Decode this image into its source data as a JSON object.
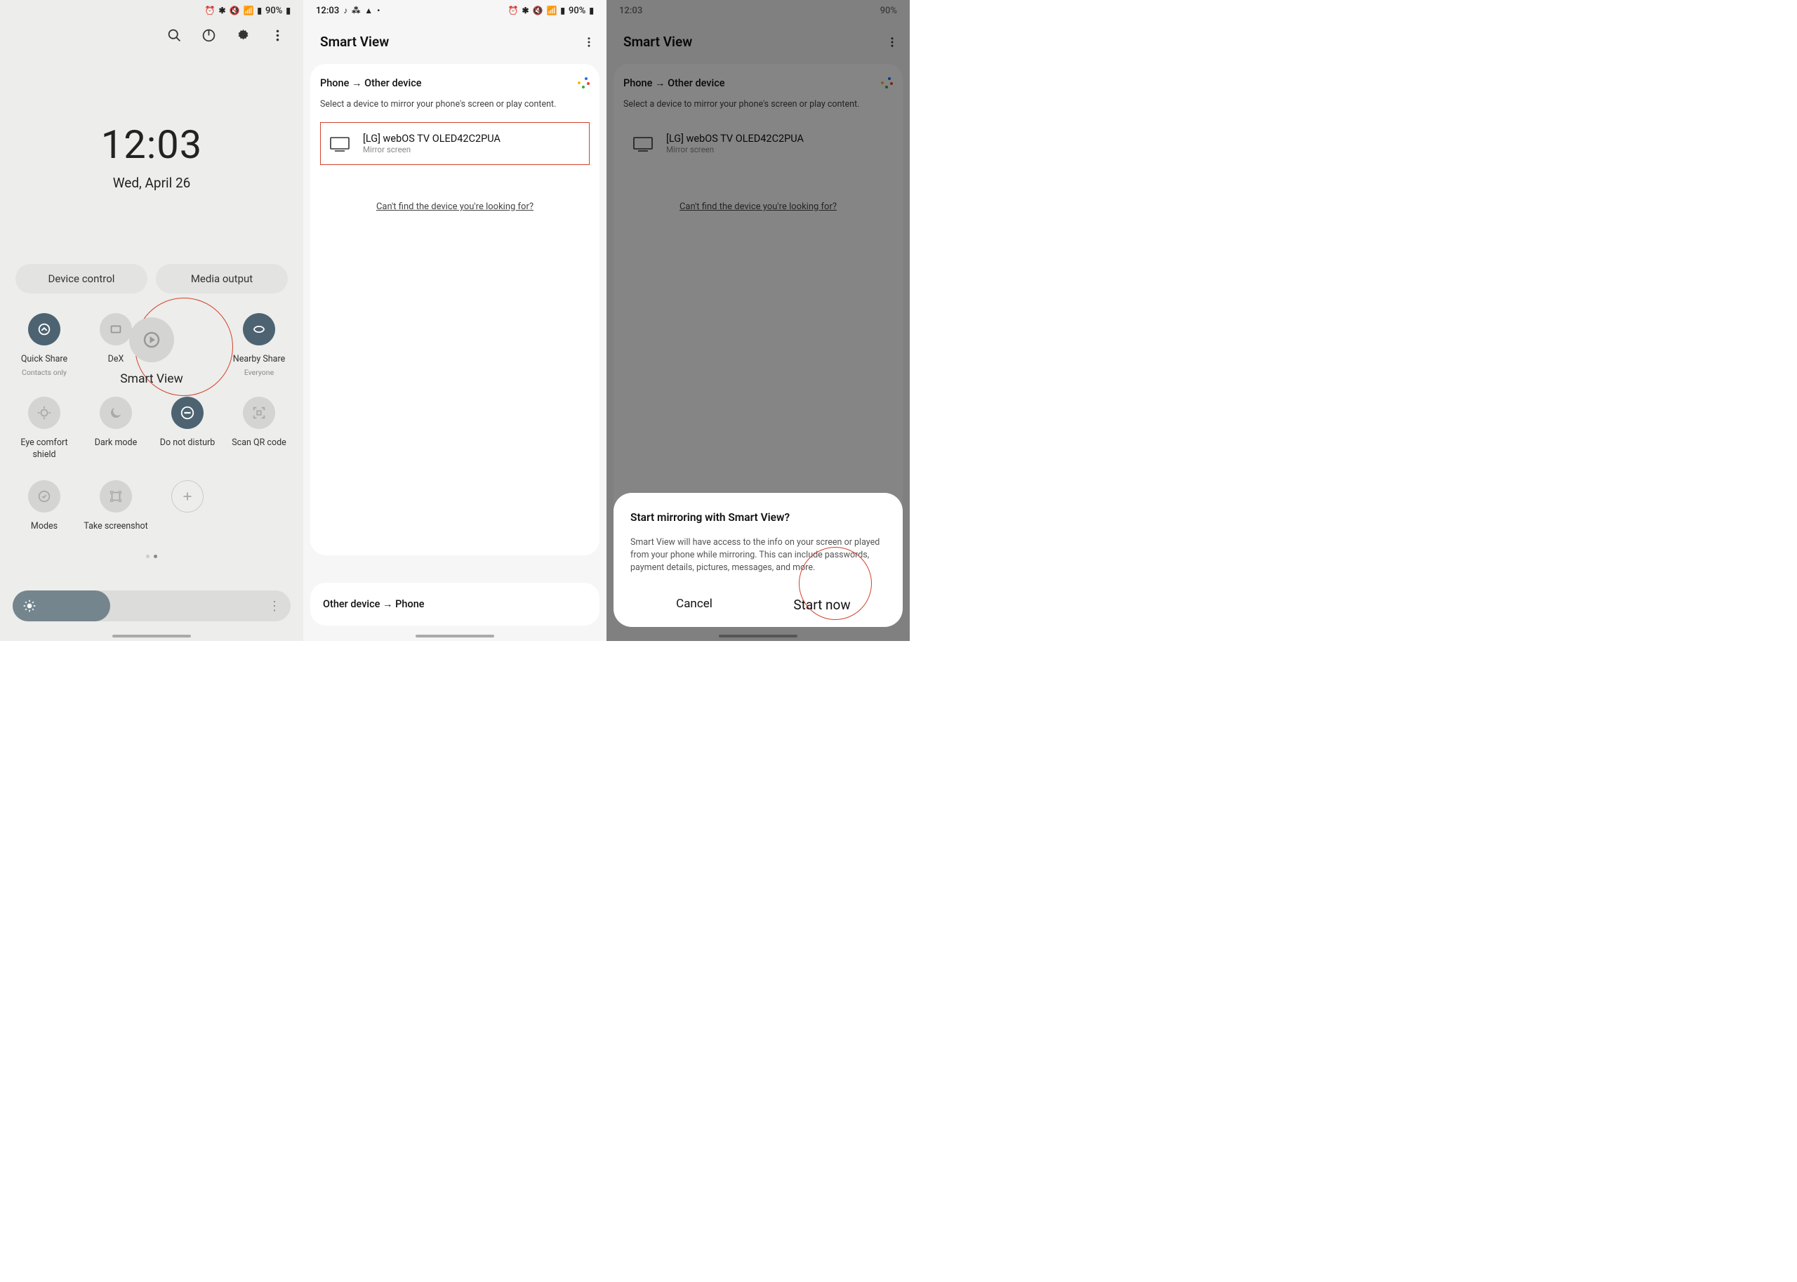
{
  "status": {
    "time": "12:03",
    "battery": "90%"
  },
  "shot1": {
    "clock_time": "12:03",
    "clock_date": "Wed, April 26",
    "pills": {
      "a": "Device control",
      "b": "Media output"
    },
    "tiles": {
      "quickshare": {
        "label": "Quick Share",
        "sub": "Contacts only"
      },
      "dex": {
        "label": "DeX"
      },
      "smartview": {
        "label": "Smart View"
      },
      "nearby": {
        "label": "Nearby Share",
        "sub": "Everyone"
      },
      "eyecomfort": {
        "label": "Eye comfort shield"
      },
      "darkmode": {
        "label": "Dark mode"
      },
      "dnd": {
        "label": "Do not disturb"
      },
      "scanqr": {
        "label": "Scan QR code"
      },
      "modes": {
        "label": "Modes"
      },
      "screenshot": {
        "label": "Take screenshot"
      },
      "add": {
        "label": ""
      }
    }
  },
  "smartview": {
    "title": "Smart View",
    "direction_out": "Phone → Other device",
    "hint": "Select a device to mirror your phone's screen or play content.",
    "device": {
      "name": "[LG] webOS TV OLED42C2PUA",
      "sub": "Mirror screen"
    },
    "nofind": "Can't find the device you're looking for?",
    "direction_in": "Other device → Phone"
  },
  "modal": {
    "title": "Start mirroring with Smart View?",
    "body": "Smart View will have access to the info on your screen or played from your phone while mirroring. This can include passwords, payment details, pictures, messages, and more.",
    "cancel": "Cancel",
    "start": "Start now"
  }
}
